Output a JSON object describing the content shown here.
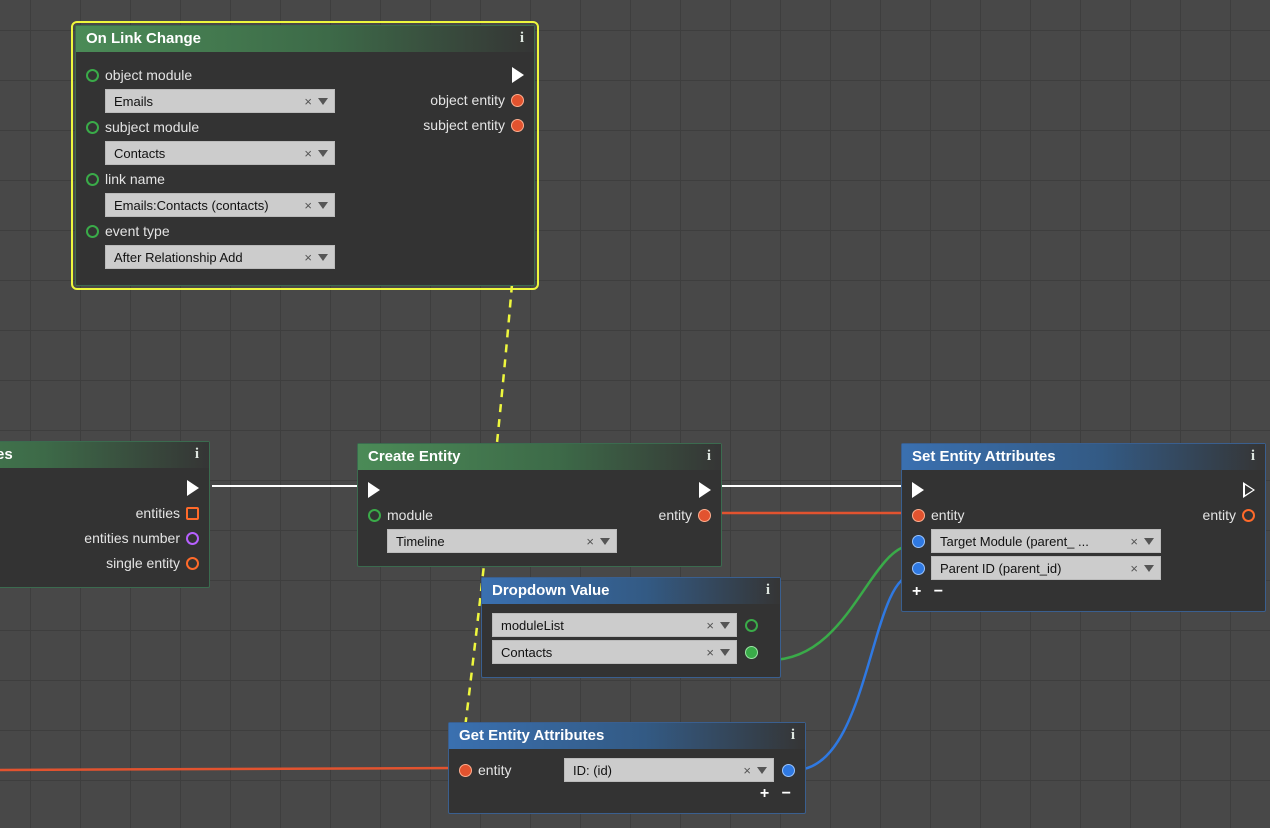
{
  "nodes": {
    "on_link_change": {
      "title": "On Link Change",
      "inputs": {
        "object_module": {
          "label": "object module",
          "value": "Emails"
        },
        "subject_module": {
          "label": "subject module",
          "value": "Contacts"
        },
        "link_name": {
          "label": "link name",
          "value": "Emails:Contacts (contacts)"
        },
        "event_type": {
          "label": "event type",
          "value": "After Relationship Add"
        }
      },
      "outputs": {
        "object_entity": "object entity",
        "subject_entity": "subject entity"
      }
    },
    "left_partial": {
      "title_suffix": "tes",
      "outputs": {
        "entities": "entities",
        "entities_number": "entities number",
        "single_entity": "single entity"
      }
    },
    "create_entity": {
      "title": "Create Entity",
      "inputs": {
        "module": {
          "label": "module",
          "value": "Timeline"
        }
      },
      "outputs": {
        "entity": "entity"
      }
    },
    "set_entity_attributes": {
      "title": "Set Entity Attributes",
      "inputs": {
        "entity": "entity",
        "target_module": {
          "value": "Target Module (parent_ ..."
        },
        "parent_id": {
          "value": "Parent ID (parent_id)"
        }
      },
      "outputs": {
        "entity": "entity"
      },
      "plusminus": "+ −"
    },
    "dropdown_value": {
      "title": "Dropdown Value",
      "rows": {
        "list": "moduleList",
        "value": "Contacts"
      }
    },
    "get_entity_attributes": {
      "title": "Get Entity Attributes",
      "input_label": "entity",
      "field": "ID: (id)",
      "plusminus": "+ −"
    }
  }
}
